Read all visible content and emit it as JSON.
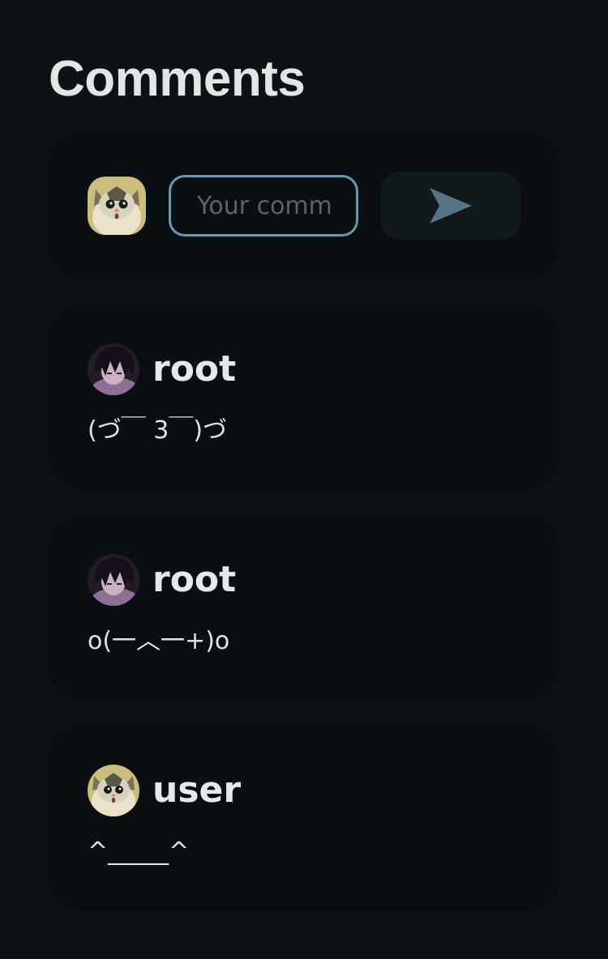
{
  "header": {
    "title": "Comments"
  },
  "composer": {
    "placeholder": "Your comm",
    "value": "",
    "avatar_icon": "cat-avatar-icon",
    "send_icon": "send-icon",
    "accent_color": "#6a97ab"
  },
  "comments": [
    {
      "username": "root",
      "text": "(づ￣ 3￣)づ",
      "avatar_icon": "anime-avatar-icon"
    },
    {
      "username": "root",
      "text": "o(一︿一+)o",
      "avatar_icon": "anime-avatar-icon"
    },
    {
      "username": "user",
      "text": "^_____^",
      "avatar_icon": "cat-avatar-icon"
    }
  ]
}
